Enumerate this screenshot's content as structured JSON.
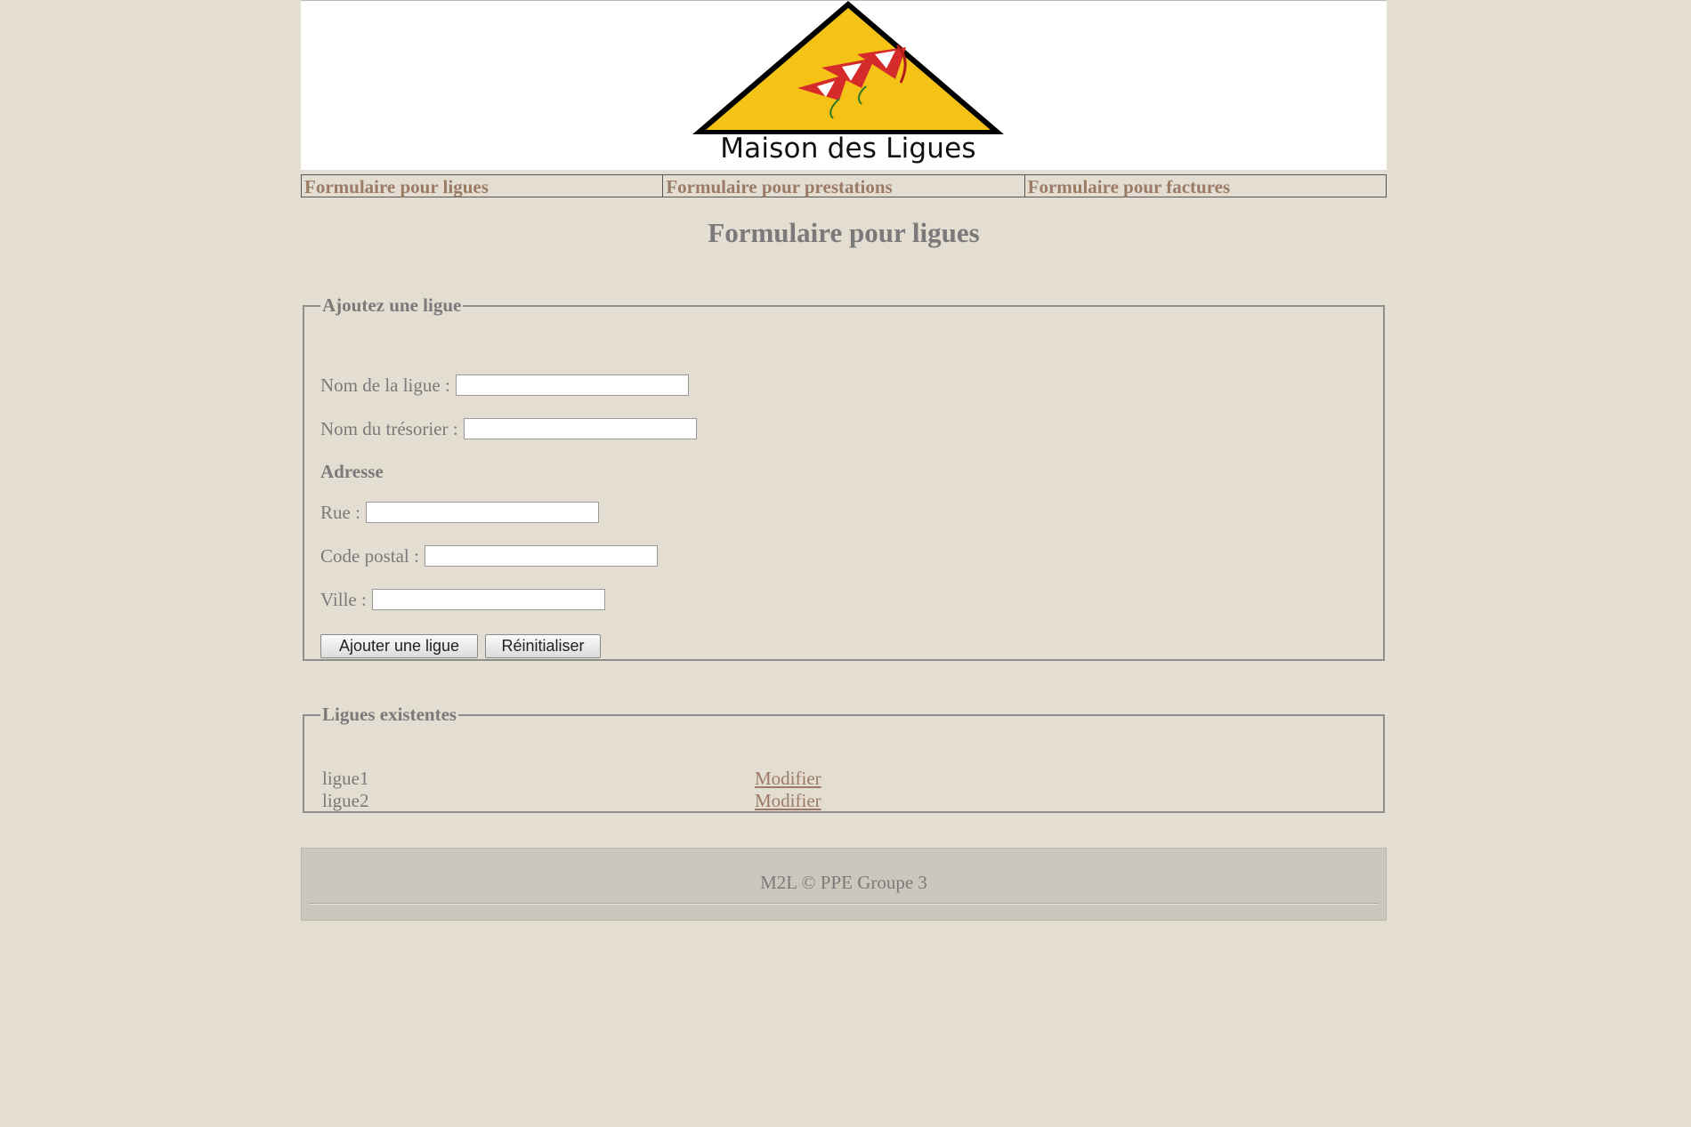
{
  "header": {
    "logo_text": "Maison des Ligues"
  },
  "nav": {
    "items": [
      {
        "label": "Formulaire pour ligues"
      },
      {
        "label": "Formulaire pour prestations"
      },
      {
        "label": "Formulaire pour factures"
      }
    ]
  },
  "page_title": "Formulaire pour ligues",
  "add_form": {
    "legend": "Ajoutez une ligue",
    "fields": {
      "nom_ligue": {
        "label": "Nom de la ligue :",
        "value": ""
      },
      "nom_tresorier": {
        "label": "Nom du trésorier :",
        "value": ""
      },
      "rue": {
        "label": "Rue :",
        "value": ""
      },
      "code_postal": {
        "label": "Code postal :",
        "value": ""
      },
      "ville": {
        "label": "Ville :",
        "value": ""
      }
    },
    "address_heading": "Adresse",
    "submit_label": "Ajouter une ligue",
    "reset_label": "Réinitialiser"
  },
  "list": {
    "legend": "Ligues existentes",
    "rows": [
      {
        "name": "ligue1",
        "action": "Modifier"
      },
      {
        "name": "ligue2",
        "action": "Modifier"
      }
    ]
  },
  "footer": {
    "text": "M2L © PPE Groupe 3"
  },
  "colors": {
    "background": "#e4ded2",
    "link": "#9b7b66",
    "text": "#7a7a7a",
    "logo_yellow": "#f5c316",
    "footer_bg": "#cbc7bd"
  }
}
